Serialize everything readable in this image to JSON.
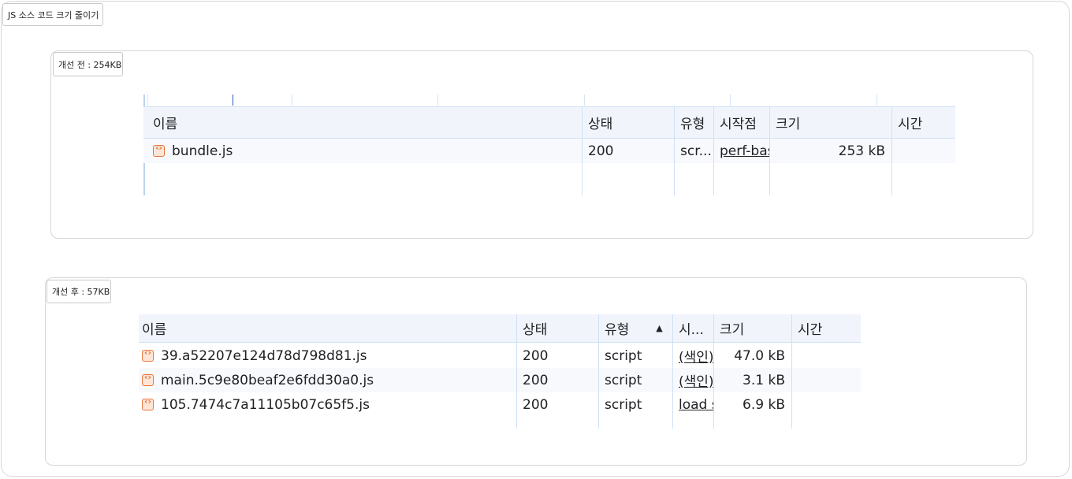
{
  "page_title": "JS 소스 코드 크기 줄이기",
  "before": {
    "label": "개선 전 : 254KB",
    "columns": [
      "이름",
      "상태",
      "유형",
      "시작점",
      "크기",
      "시간"
    ],
    "rows": [
      {
        "name": "bundle.js",
        "status": "200",
        "type": "scr...",
        "initiator": "perf-bas",
        "size": "253 kB",
        "time": ""
      }
    ]
  },
  "after": {
    "label": "개선 후 : 57KB",
    "columns": [
      "이름",
      "상태",
      "유형",
      "시...",
      "크기",
      "시간"
    ],
    "sort_indicator": "▲",
    "rows": [
      {
        "name": "39.a52207e124d78d798d81.js",
        "status": "200",
        "type": "script",
        "initiator": "(색인)",
        "size": "47.0 kB",
        "time": ""
      },
      {
        "name": "main.5c9e80beaf2e6fdd30a0.js",
        "status": "200",
        "type": "script",
        "initiator": "(색인)",
        "size": "3.1 kB",
        "time": ""
      },
      {
        "name": "105.7474c7a11105b07c65f5.js",
        "status": "200",
        "type": "script",
        "initiator": "load s",
        "size": "6.9 kB",
        "time": ""
      }
    ]
  },
  "colors": {
    "accent": "#e8763a",
    "grid": "#cfe0f5",
    "header_bg": "#f1f5fb"
  }
}
